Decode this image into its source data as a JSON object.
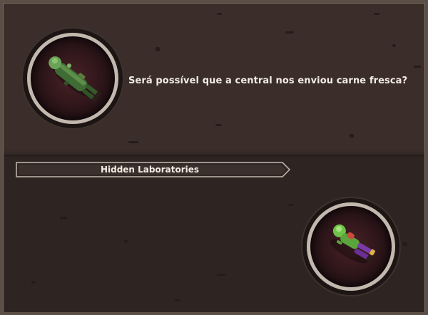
{
  "dialogue": {
    "text": "Será possível que a central nos enviou carne fresca?",
    "speaker_icon": "zombie-soldier-portrait-icon"
  },
  "location": {
    "label": "Hidden Laboratories"
  },
  "responder": {
    "icon": "zombie-survivor-portrait-icon"
  },
  "colors": {
    "panel_top": "#3b2e2a",
    "panel_bottom": "#2e2523",
    "portrait_ring": "#c2b8ae",
    "text": "#f3ece4"
  }
}
